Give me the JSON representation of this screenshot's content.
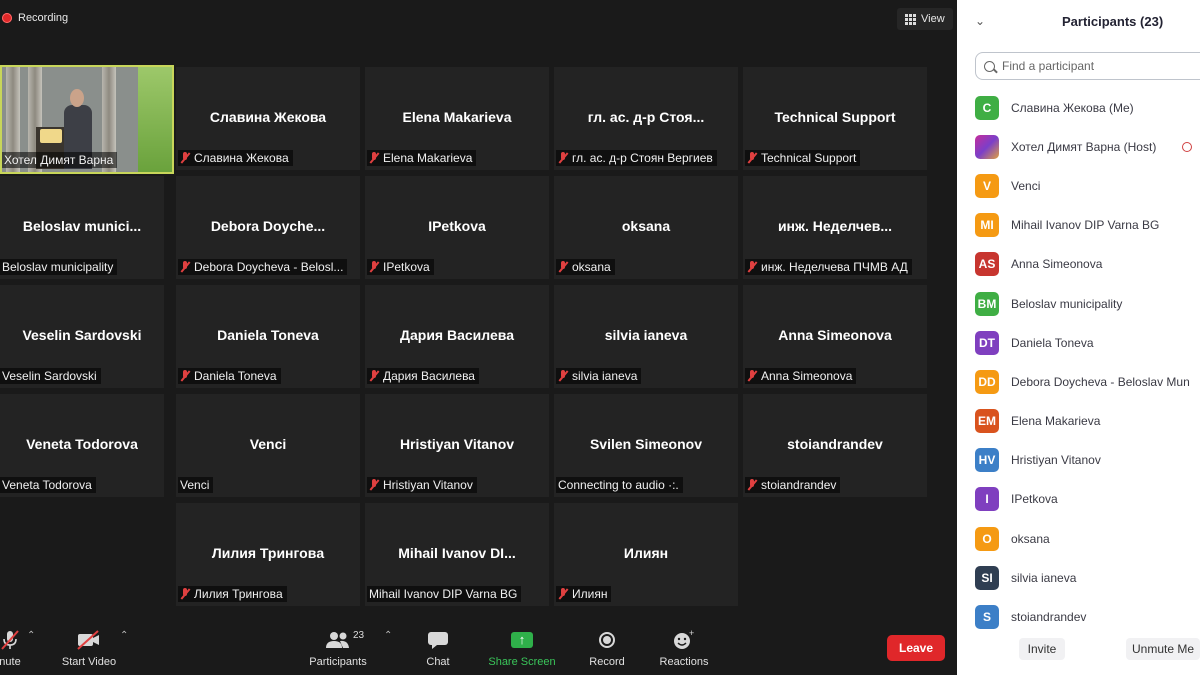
{
  "recording": {
    "label": "Recording"
  },
  "view_button": {
    "label": "View"
  },
  "video_tile": {
    "label": "Хотел Димят Варна",
    "podium_logo_text": "Dimyat"
  },
  "tiles": [
    {
      "display_name": "Славина Жекова",
      "label": "Славина Жекова",
      "muted": true
    },
    {
      "display_name": "Elena Makarieva",
      "label": "Elena Makarieva",
      "muted": true
    },
    {
      "display_name": "гл. ас. д-р Стоя...",
      "label": "гл. ас. д-р Стоян Вергиев",
      "muted": true
    },
    {
      "display_name": "Technical Support",
      "label": "Technical Support",
      "muted": true
    },
    {
      "display_name": "Beloslav munici...",
      "label": "Beloslav municipality",
      "muted": false
    },
    {
      "display_name": "Debora Doyche...",
      "label": "Debora Doycheva - Belosl...",
      "muted": true
    },
    {
      "display_name": "IPetkova",
      "label": "IPetkova",
      "muted": true
    },
    {
      "display_name": "oksana",
      "label": "oksana",
      "muted": true
    },
    {
      "display_name": "инж. Неделчев...",
      "label": "инж. Неделчева ПЧМВ АД",
      "muted": true
    },
    {
      "display_name": "Veselin Sardovski",
      "label": "Veselin Sardovski",
      "muted": false
    },
    {
      "display_name": "Daniela Toneva",
      "label": "Daniela Toneva",
      "muted": true
    },
    {
      "display_name": "Дария Василева",
      "label": "Дария Василева",
      "muted": true
    },
    {
      "display_name": "silvia ianeva",
      "label": "silvia ianeva",
      "muted": true
    },
    {
      "display_name": "Anna Simeonova",
      "label": "Anna Simeonova",
      "muted": true
    },
    {
      "display_name": "Veneta Todorova",
      "label": "Veneta Todorova",
      "muted": false
    },
    {
      "display_name": "Venci",
      "label": "Venci",
      "muted": false
    },
    {
      "display_name": "Hristiyan Vitanov",
      "label": "Hristiyan Vitanov",
      "muted": true
    },
    {
      "display_name": "Svilen Simeonov",
      "label": "Connecting to audio ·:.",
      "muted": false
    },
    {
      "display_name": "stoiandrandev",
      "label": "stoiandrandev",
      "muted": true
    },
    {
      "display_name": "Лилия Тринговa",
      "label": "Лилия Тринговa",
      "muted": true
    },
    {
      "display_name": "Mihail Ivanov DI...",
      "label": "Mihail Ivanov DIP Varna BG",
      "muted": false
    },
    {
      "display_name": "Илиян",
      "label": "Илиян",
      "muted": true
    }
  ],
  "toolbar": {
    "unmute_label": "nute",
    "start_video_label": "Start Video",
    "participants_label": "Participants",
    "participants_count": "23",
    "chat_label": "Chat",
    "share_screen_label": "Share Screen",
    "record_label": "Record",
    "reactions_label": "Reactions",
    "leave_label": "Leave",
    "share_screen_color": "#2fb04a",
    "leave_color": "#e0272a"
  },
  "panel": {
    "title": "Participants (23)",
    "search_placeholder": "Find a participant",
    "invite_label": "Invite",
    "unmute_me_label": "Unmute Me",
    "participants": [
      {
        "initials": "C",
        "name": "Славина Жекова (Me)",
        "color": "#3fae44"
      },
      {
        "initials": "",
        "name": "Хотел Димят Варна (Host)",
        "color": "#b03aa8",
        "image": true
      },
      {
        "initials": "V",
        "name": "Venci",
        "color": "#f59a13"
      },
      {
        "initials": "MI",
        "name": "Mihail Ivanov DIP Varna BG",
        "color": "#f59a13"
      },
      {
        "initials": "AS",
        "name": "Anna Simeonova",
        "color": "#c7352f"
      },
      {
        "initials": "BM",
        "name": "Beloslav municipality",
        "color": "#3fae44"
      },
      {
        "initials": "DT",
        "name": "Daniela Toneva",
        "color": "#7f3fbf"
      },
      {
        "initials": "DD",
        "name": "Debora Doycheva -  Beloslav Mun",
        "color": "#f59a13"
      },
      {
        "initials": "EM",
        "name": "Elena Makarieva",
        "color": "#d9531e"
      },
      {
        "initials": "HV",
        "name": "Hristiyan Vitanov",
        "color": "#3c7fc7"
      },
      {
        "initials": "I",
        "name": "IPetkova",
        "color": "#7f3fbf"
      },
      {
        "initials": "O",
        "name": "oksana",
        "color": "#f59a13"
      },
      {
        "initials": "SI",
        "name": "silvia ianeva",
        "color": "#2f3e52"
      },
      {
        "initials": "S",
        "name": "stoiandrandev",
        "color": "#3c7fc7"
      }
    ]
  }
}
